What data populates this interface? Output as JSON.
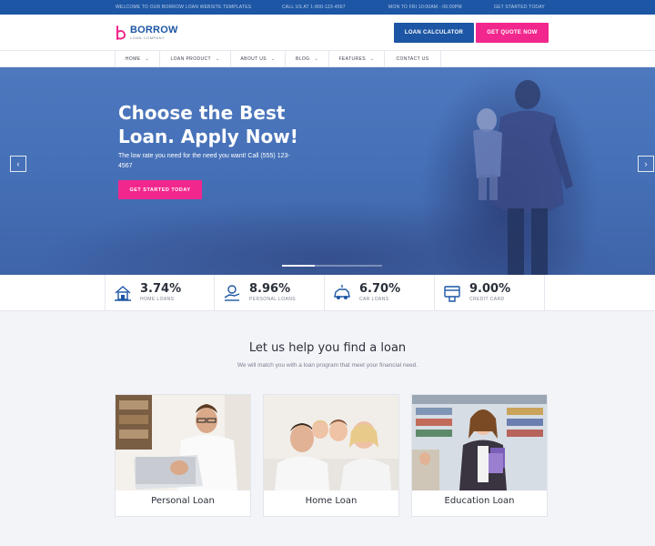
{
  "topbar": {
    "welcome": "WELCOME TO OUR BORROW LOAN WEBSITE TEMPLATES",
    "phone": "CALL US AT 1-800-123-4567",
    "hours": "MON TO FRI 10:00AM - 06:00PM",
    "get_started": "GET STARTED TODAY"
  },
  "brand": {
    "name": "BORROW",
    "tagline": "LOAN-COMPANY",
    "color": "#1d56a4"
  },
  "header": {
    "loan_calculator": "LOAN CALCULATOR",
    "get_quote": "GET QUOTE NOW"
  },
  "nav": {
    "items": [
      {
        "label": "HOME",
        "has_dropdown": true
      },
      {
        "label": "LOAN PRODUCT",
        "has_dropdown": true
      },
      {
        "label": "ABOUT US",
        "has_dropdown": true
      },
      {
        "label": "BLOG",
        "has_dropdown": true
      },
      {
        "label": "FEATURES",
        "has_dropdown": true
      },
      {
        "label": "CONTACT US",
        "has_dropdown": false
      }
    ]
  },
  "hero": {
    "title": "Choose the Best Loan. Apply Now!",
    "subtitle": "The low rate you need for the need you want! Call (555) 123-4567",
    "cta": "GET STARTED TODAY",
    "prev_icon": "chevron-left-icon",
    "next_icon": "chevron-right-icon",
    "slide_progress": 0.33
  },
  "rates": [
    {
      "value": "3.74%",
      "label": "HOME LOANS",
      "icon": "house-icon"
    },
    {
      "value": "8.96%",
      "label": "PERSONAL LOANS",
      "icon": "hand-money-icon"
    },
    {
      "value": "6.70%",
      "label": "CAR LOANS",
      "icon": "car-icon"
    },
    {
      "value": "9.00%",
      "label": "CREDIT CARD",
      "icon": "credit-card-icon"
    }
  ],
  "section": {
    "title": "Let us help you find a loan",
    "subtitle": "We will match you with a loan program that meet your financial need."
  },
  "cards": [
    {
      "label": "Personal Loan"
    },
    {
      "label": "Home Loan"
    },
    {
      "label": "Education Loan"
    }
  ],
  "colors": {
    "primary": "#1d56a4",
    "accent": "#f2278d",
    "background": "#f3f4f8"
  }
}
